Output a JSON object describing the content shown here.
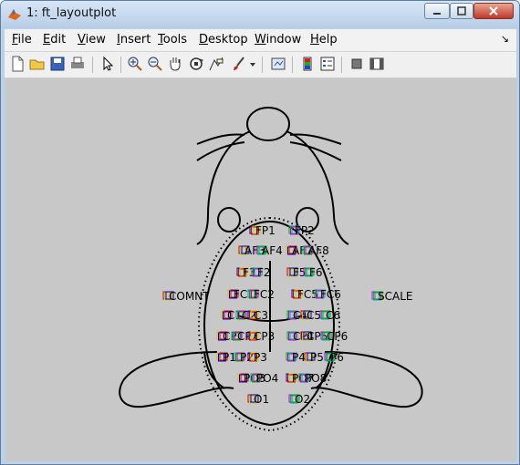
{
  "window": {
    "title": "1: ft_layoutplot"
  },
  "menu": [
    {
      "label": "File",
      "u": "F",
      "rest": "ile"
    },
    {
      "label": "Edit",
      "u": "E",
      "rest": "dit"
    },
    {
      "label": "View",
      "u": "V",
      "rest": "iew"
    },
    {
      "label": "Insert",
      "u": "I",
      "rest": "nsert"
    },
    {
      "label": "Tools",
      "u": "T",
      "rest": "ools"
    },
    {
      "label": "Desktop",
      "u": "D",
      "rest": "esktop"
    },
    {
      "label": "Window",
      "u": "W",
      "rest": "indow"
    },
    {
      "label": "Help",
      "u": "H",
      "rest": "elp"
    }
  ],
  "toolbar": [
    {
      "icon": "new-figure-icon"
    },
    {
      "icon": "open-file-icon"
    },
    {
      "icon": "save-icon"
    },
    {
      "icon": "print-icon"
    },
    {
      "icon": "edit-plot-arrow-icon"
    },
    {
      "icon": "zoom-in-icon"
    },
    {
      "icon": "zoom-out-icon"
    },
    {
      "icon": "pan-hand-icon"
    },
    {
      "icon": "rotate-3d-icon"
    },
    {
      "icon": "data-cursor-icon"
    },
    {
      "icon": "brush-icon"
    },
    {
      "icon": "brush-dropdown-icon"
    },
    {
      "icon": "link-plot-icon"
    },
    {
      "icon": "insert-colorbar-icon"
    },
    {
      "icon": "insert-legend-icon"
    },
    {
      "icon": "hide-plot-tools-icon"
    },
    {
      "icon": "show-plot-tools-icon"
    }
  ],
  "layout_labels": [
    "FP1",
    "FP2",
    "AF3",
    "AF4",
    "AF7",
    "AF8",
    "F3",
    "F2",
    "F5",
    "F6",
    "FC1",
    "FC2",
    "FC5",
    "FC6",
    "COMNT",
    "SCALE",
    "C1",
    "C2",
    "C3",
    "C4",
    "C5",
    "C6",
    "CP1",
    "CP2",
    "CP3",
    "CP4",
    "CP5",
    "CP6",
    "P1",
    "P2",
    "P3",
    "P4",
    "P5",
    "P6",
    "PO3",
    "PO4",
    "PO7",
    "PO8",
    "O1",
    "O2"
  ],
  "colors": {
    "canvas_bg": "#c8c8c8",
    "outline": "#000000",
    "marker_blue": "#0000cc",
    "marker_green": "#00aa00",
    "marker_red": "#dd0000",
    "marker_magenta": "#cc00cc",
    "marker_yellow": "#cccc00",
    "marker_cyan": "#00aaaa"
  }
}
